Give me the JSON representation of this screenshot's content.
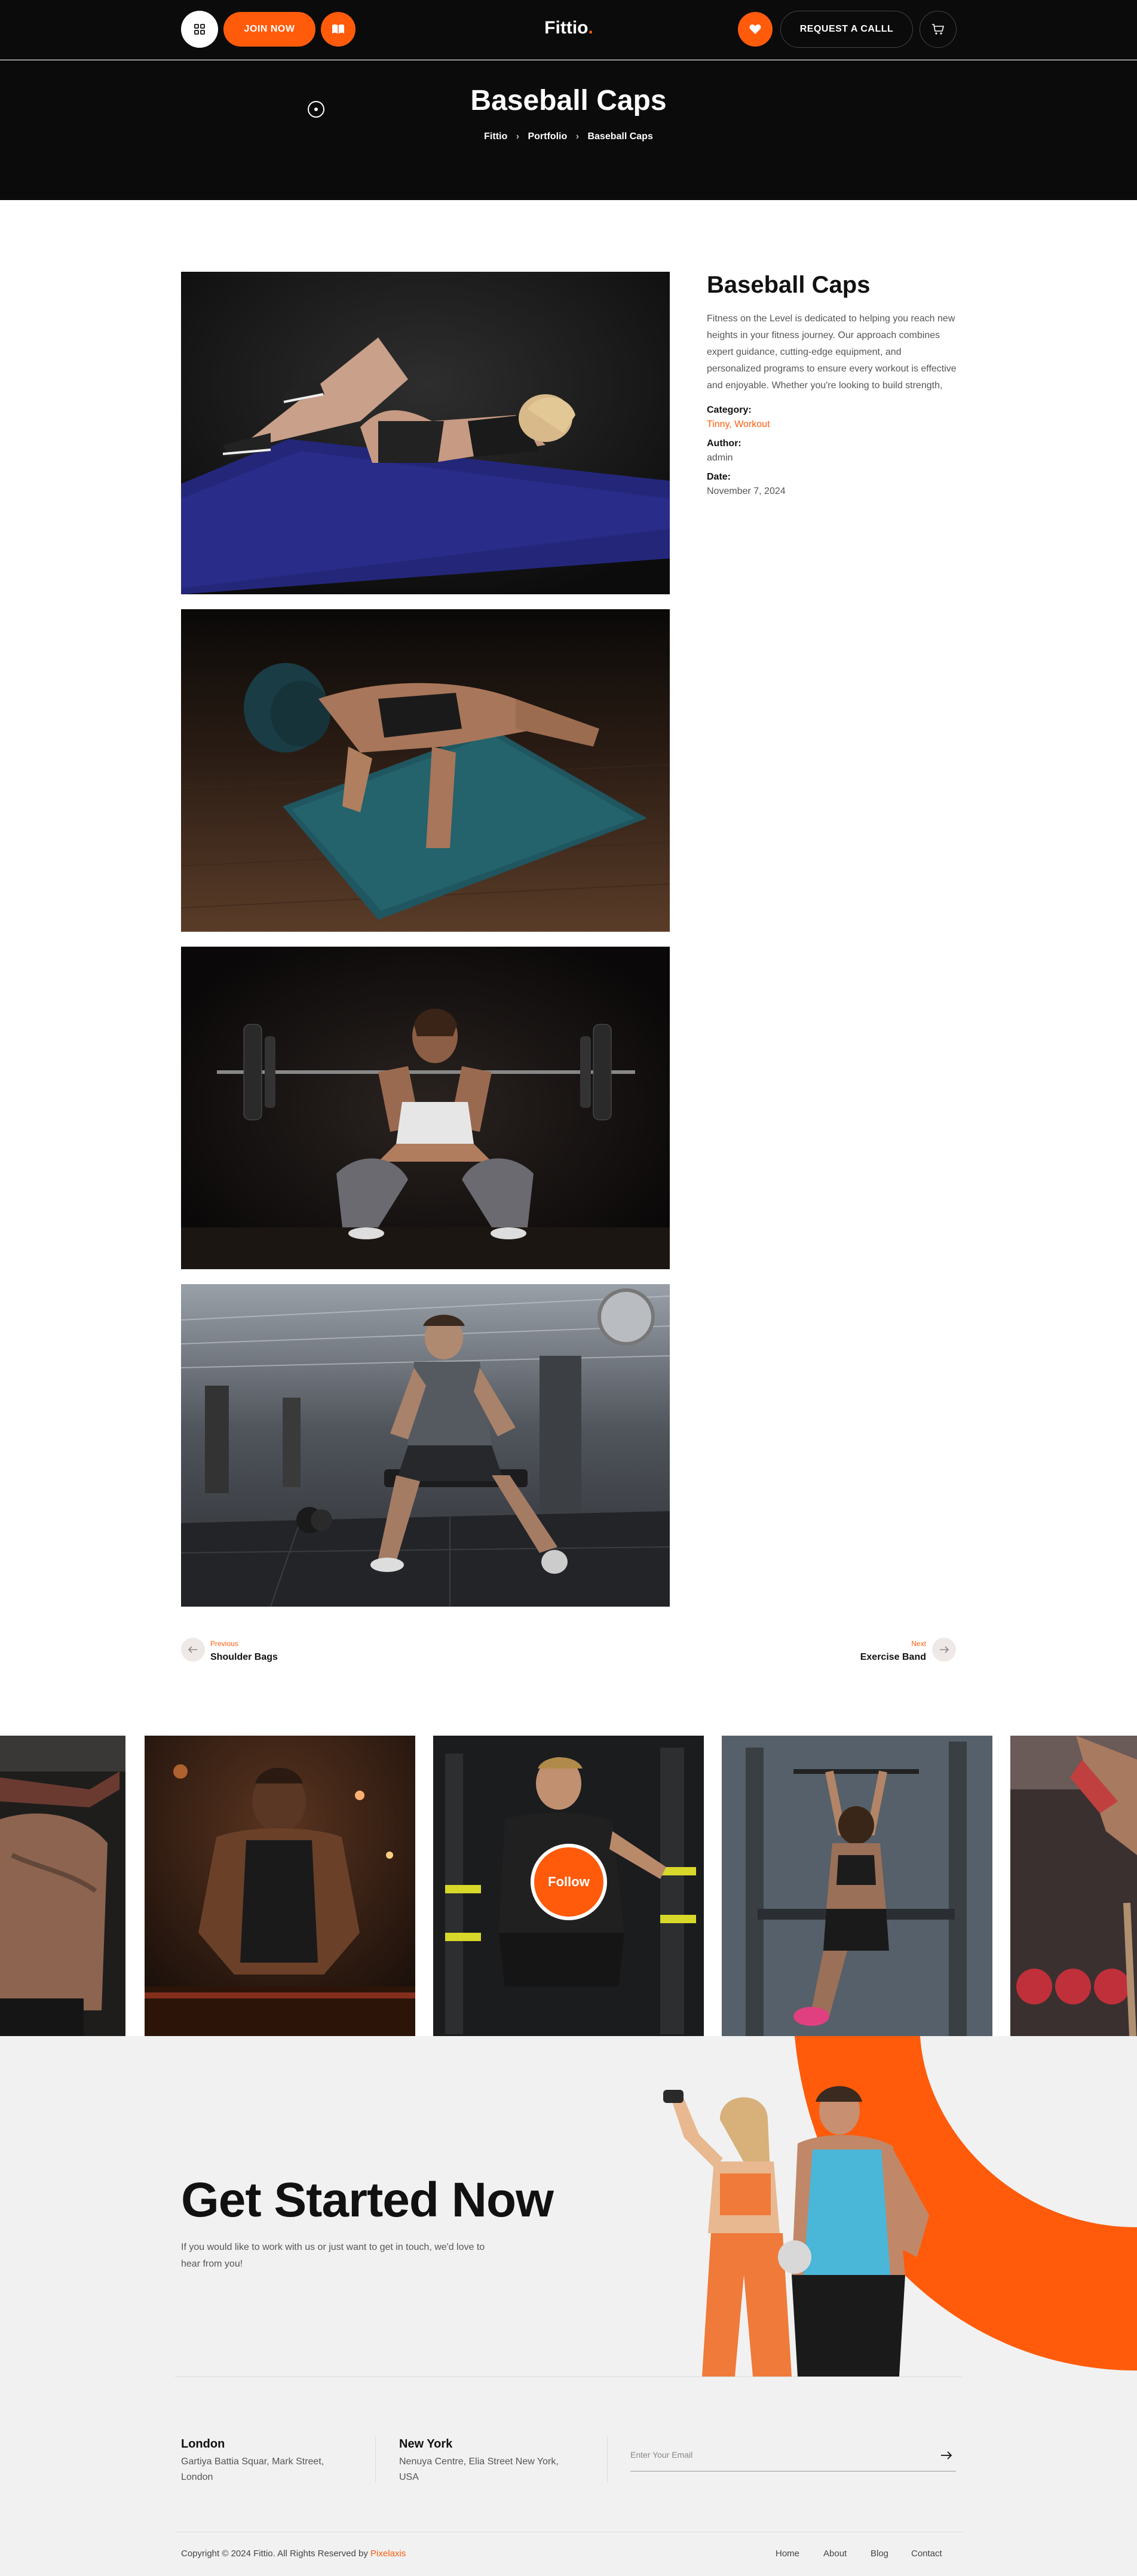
{
  "header": {
    "join_label": "JOIN NOW",
    "logo_text": "Fittio",
    "logo_dot": ".",
    "request_label": "REQUEST A CALLL",
    "icons": [
      "grid-icon",
      "book-icon",
      "heart-icon",
      "cart-icon"
    ]
  },
  "hero": {
    "title": "Baseball Caps",
    "breadcrumb": [
      "Fittio",
      "Portfolio",
      "Baseball Caps"
    ]
  },
  "gallery": {
    "images": [
      "woman-crunch-on-mat-photo",
      "woman-pushup-on-mat-photo",
      "woman-barbell-squat-photo",
      "man-dumbbell-curl-gym-photo"
    ]
  },
  "details": {
    "title": "Baseball Caps",
    "description": "Fitness on the Level is dedicated to helping you reach new heights in your fitness journey. Our approach combines expert guidance, cutting-edge equipment, and personalized programs to ensure every workout is effective and enjoyable. Whether you're looking to build strength,",
    "category_label": "Category:",
    "category_value": "Tinny, Workout",
    "author_label": "Author:",
    "author_value": "admin",
    "date_label": "Date:",
    "date_value": "November 7, 2024"
  },
  "pager": {
    "prev_small": "Previous",
    "prev_title": "Shoulder Bags",
    "next_small": "Next",
    "next_title": "Exercise Band"
  },
  "instagram": {
    "follow_label": "Follow"
  },
  "cta": {
    "title": "Get Started Now",
    "subtitle": "If you would like to work with us or just want to get in touch, we'd love to hear from you!",
    "city1": "London",
    "addr1": "Gartiya Battia Squar, Mark Street, London",
    "city2": "New York",
    "addr2": "Nenuya Centre, Elia Street New York, USA",
    "email_placeholder": "Enter Your Email"
  },
  "footer": {
    "copyright": "Copyright © 2024 Fittio. All Rights Reserved by ",
    "brand": "Pixelaxis",
    "nav": [
      "Home",
      "About",
      "Blog",
      "Contact"
    ]
  },
  "colors": {
    "accent": "#ff5b0b",
    "dark": "#0b0b0b",
    "light_bg": "#f1f1f1"
  }
}
